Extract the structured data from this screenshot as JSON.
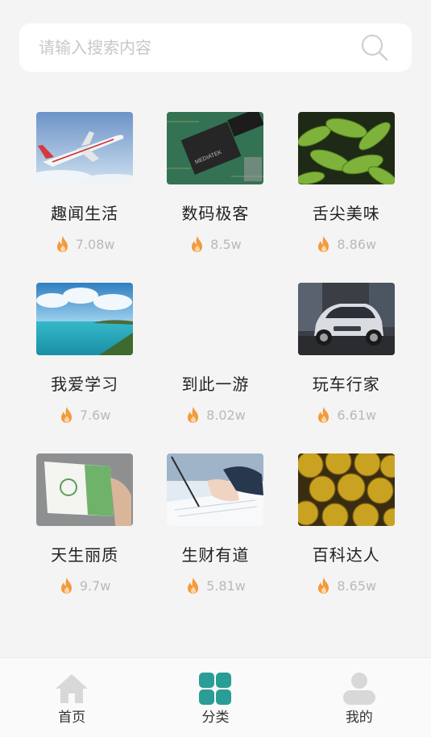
{
  "search": {
    "placeholder": "请输入搜索内容",
    "icon": "search-icon"
  },
  "categories": [
    {
      "title": "趣闻生活",
      "count": "7.08w",
      "image": "airplane"
    },
    {
      "title": "数码极客",
      "count": "8.5w",
      "image": "chip"
    },
    {
      "title": "舌尖美味",
      "count": "8.86w",
      "image": "edamame"
    },
    {
      "title": "我爱学习",
      "count": "7.6w",
      "image": "seascape"
    },
    {
      "title": "到此一游",
      "count": "8.02w",
      "image": ""
    },
    {
      "title": "玩车行家",
      "count": "6.61w",
      "image": "car"
    },
    {
      "title": "天生丽质",
      "count": "9.7w",
      "image": "cosmetic-tube"
    },
    {
      "title": "生财有道",
      "count": "5.81w",
      "image": "signing-document"
    },
    {
      "title": "百科达人",
      "count": "8.65w",
      "image": "durian"
    }
  ],
  "tabbar": {
    "items": [
      {
        "label": "首页",
        "icon": "home-icon",
        "active": false
      },
      {
        "label": "分类",
        "icon": "category-icon",
        "active": true
      },
      {
        "label": "我的",
        "icon": "user-icon",
        "active": false
      }
    ]
  },
  "colors": {
    "accent": "#2a9d96",
    "fire": "#f39a3c",
    "inactive_icon": "#d8d8d8"
  }
}
